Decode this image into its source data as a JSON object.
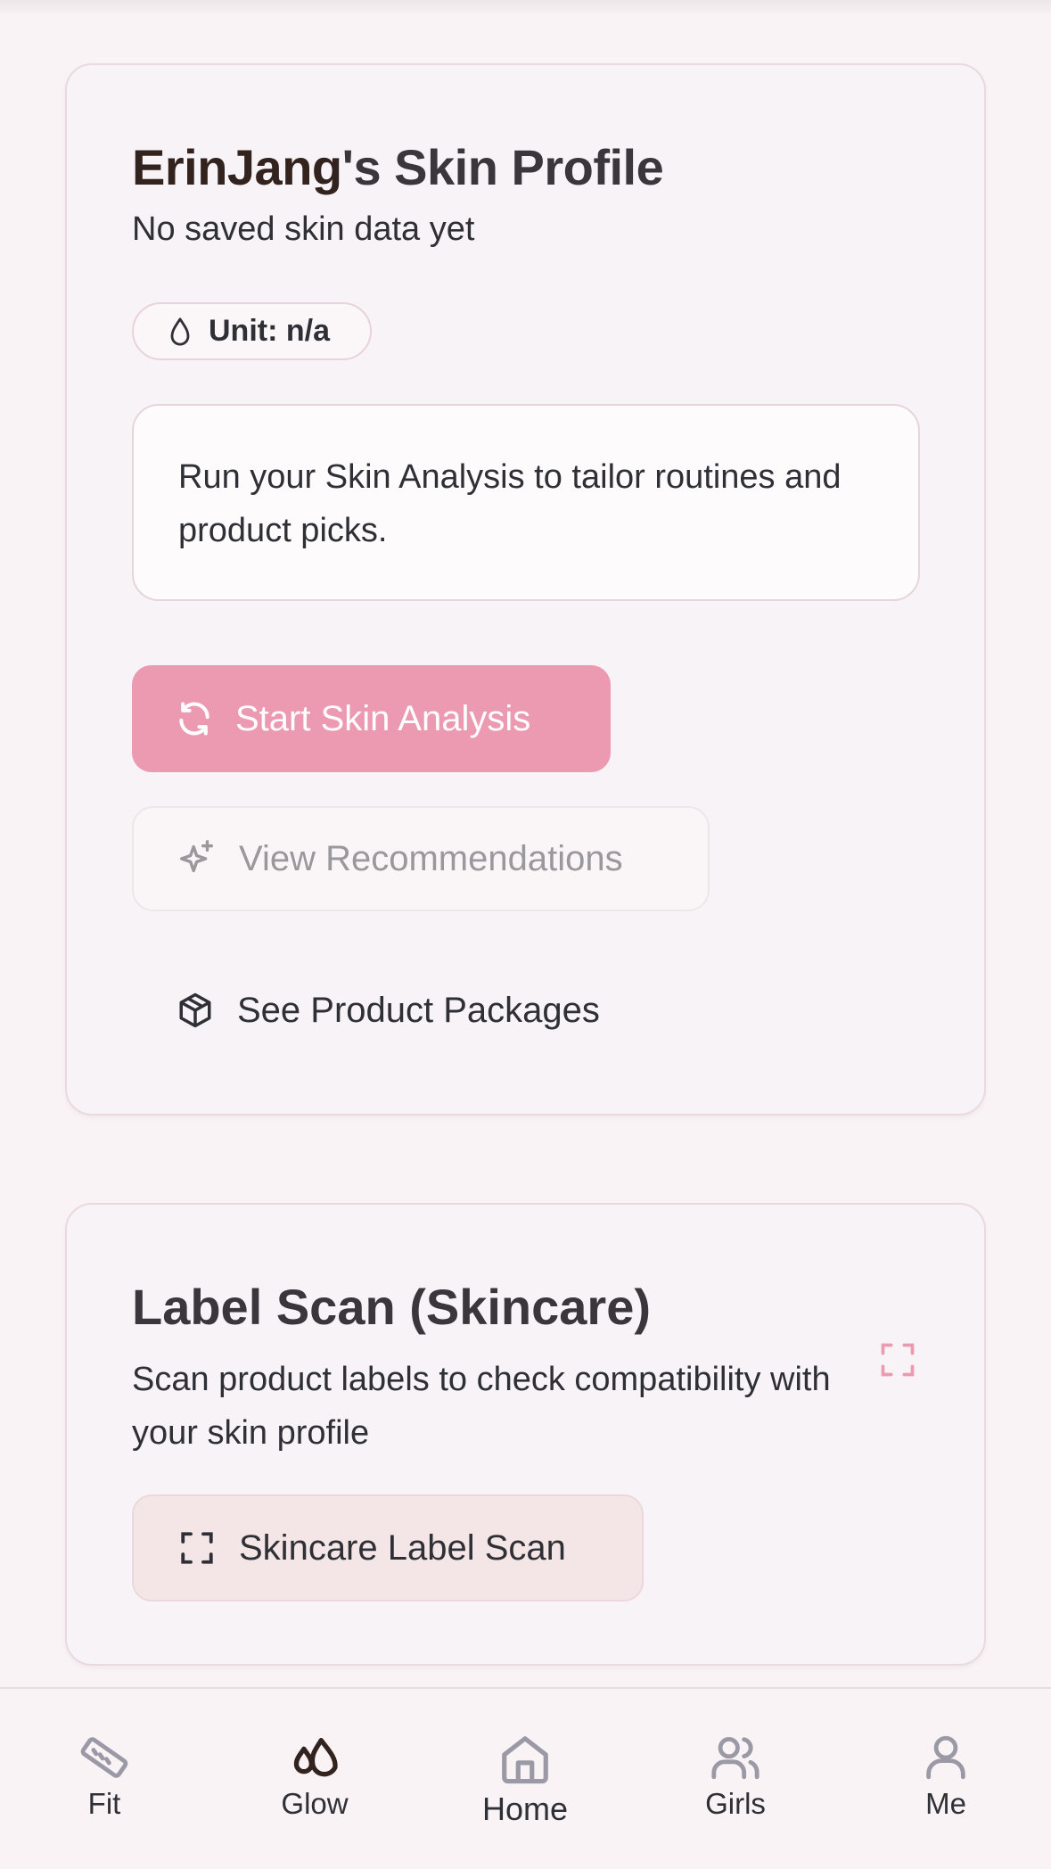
{
  "profile": {
    "title_name": "ErinJang",
    "title_rest": "'s Skin Profile",
    "subtitle": "No saved skin data yet",
    "unit_label": "Unit: n/a",
    "info_text": "Run your Skin Analysis to tailor routines and product picks.",
    "start_button": "Start Skin Analysis",
    "recommendations_button": "View Recommendations",
    "packages_link": "See Product Packages"
  },
  "label_scan": {
    "title": "Label Scan (Skincare)",
    "description": "Scan product labels to check compatibility with your skin profile",
    "scan_button": "Skincare Label Scan"
  },
  "nav": {
    "items": [
      {
        "label": "Fit",
        "icon": "ruler-icon"
      },
      {
        "label": "Glow",
        "icon": "droplets-icon"
      },
      {
        "label": "Home",
        "icon": "home-icon",
        "active": true
      },
      {
        "label": "Girls",
        "icon": "users-icon"
      },
      {
        "label": "Me",
        "icon": "user-icon"
      }
    ]
  },
  "colors": {
    "accent_pink": "#ec9ab2",
    "background": "#f9f3f5",
    "nav_inactive_icon": "#9c99a6"
  }
}
